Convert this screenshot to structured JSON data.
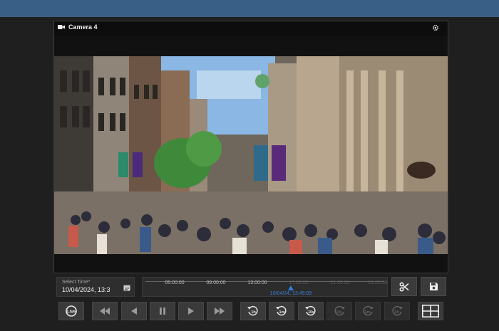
{
  "camera": {
    "title": "Camera 4"
  },
  "time_select": {
    "label": "Select Time*",
    "value": "10/04/2024, 13:3"
  },
  "timeline": {
    "labels": [
      "05:00:00",
      "09:00:00",
      "13:00:00",
      "17:00:00",
      "21:00:00",
      "01:00:00"
    ],
    "current": "10/04/24, 13:45:09"
  },
  "playback": {
    "live_label": "Live",
    "jump_back": [
      "1h",
      "1m",
      "10s"
    ],
    "jump_forward": [
      "10s",
      "1m",
      "1h"
    ]
  },
  "colors": {
    "topbar": "#3a5f86",
    "accent": "#2f7de0"
  }
}
